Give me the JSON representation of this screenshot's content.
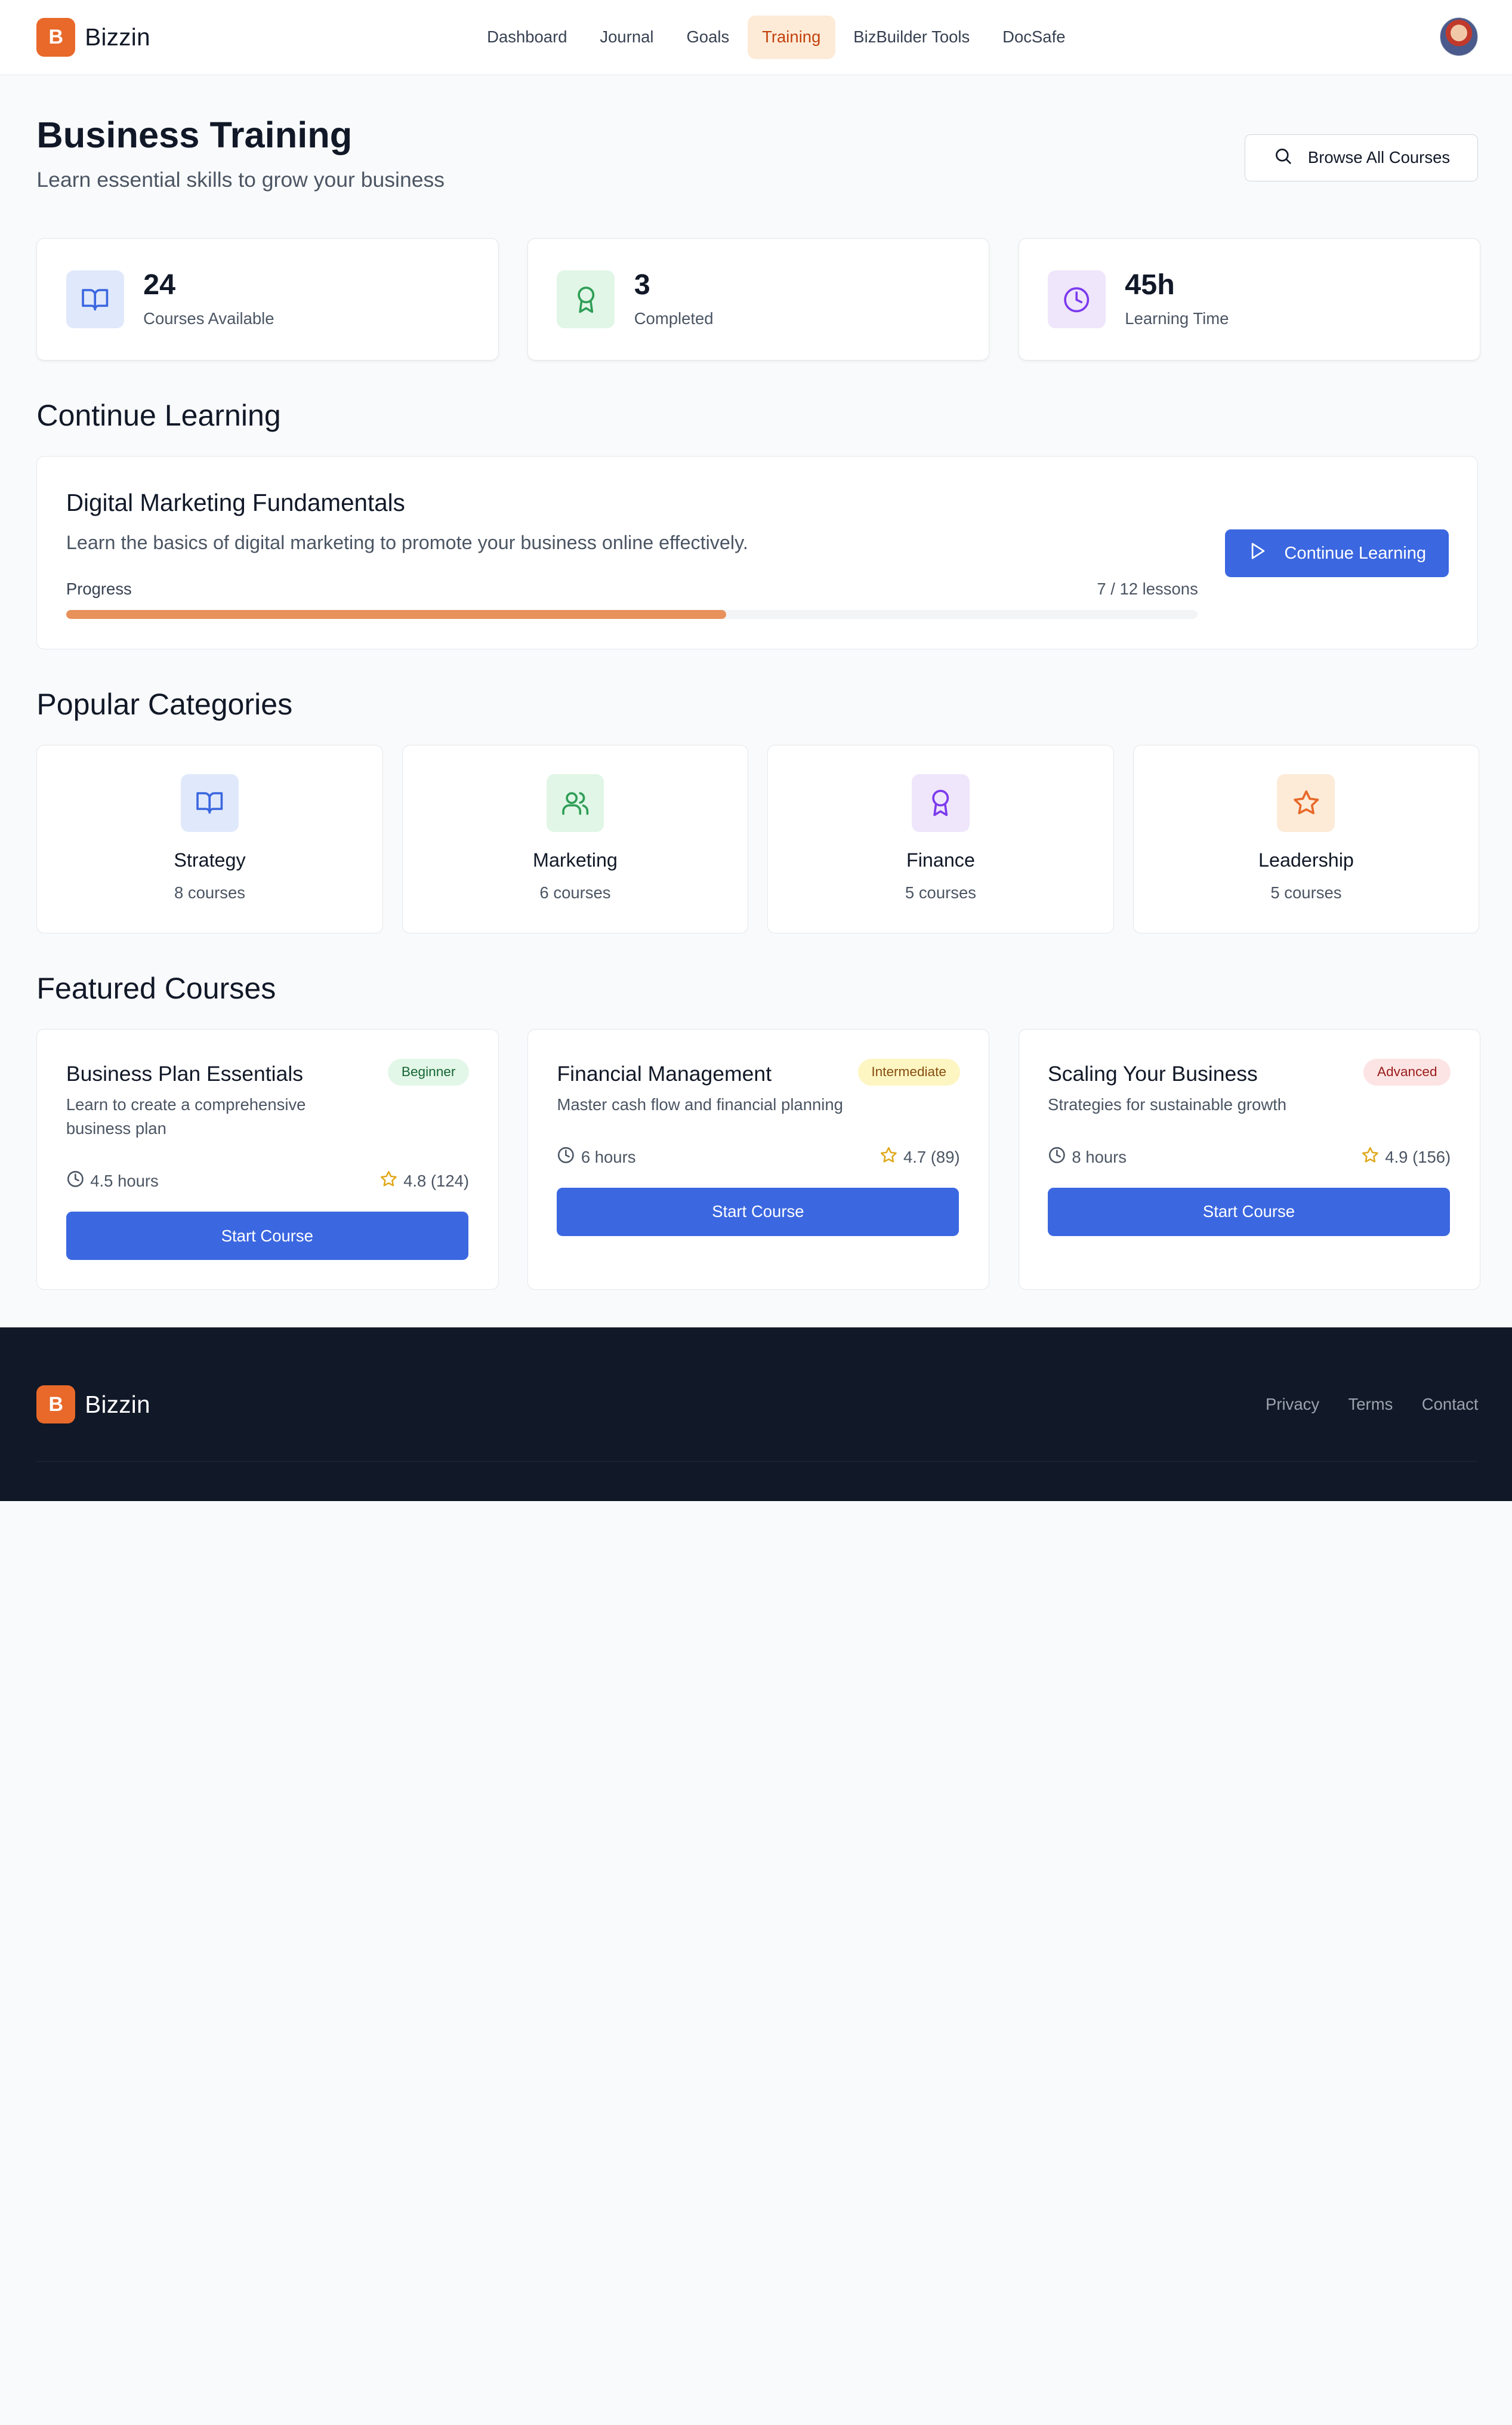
{
  "app": {
    "name": "Bizzin",
    "logo_letter": "B"
  },
  "nav": {
    "items": [
      {
        "label": "Dashboard"
      },
      {
        "label": "Journal"
      },
      {
        "label": "Goals"
      },
      {
        "label": "Training",
        "active": true
      },
      {
        "label": "BizBuilder Tools"
      },
      {
        "label": "DocSafe"
      }
    ]
  },
  "page": {
    "title": "Business Training",
    "subtitle": "Learn essential skills to grow your business",
    "browse_label": "Browse All Courses"
  },
  "stats": [
    {
      "value": "24",
      "label": "Courses Available",
      "icon": "book-open-icon"
    },
    {
      "value": "3",
      "label": "Completed",
      "icon": "award-icon"
    },
    {
      "value": "45h",
      "label": "Learning Time",
      "icon": "clock-icon"
    }
  ],
  "continue_learning": {
    "section_title": "Continue Learning",
    "course_title": "Digital Marketing Fundamentals",
    "description": "Learn the basics of digital marketing to promote your business online effectively.",
    "progress_label": "Progress",
    "progress_text": "7 / 12 lessons",
    "lessons_done": 7,
    "lessons_total": 12,
    "button_label": "Continue Learning"
  },
  "categories": {
    "section_title": "Popular Categories",
    "items": [
      {
        "name": "Strategy",
        "count": "8 courses",
        "icon": "book-open-icon"
      },
      {
        "name": "Marketing",
        "count": "6 courses",
        "icon": "users-icon"
      },
      {
        "name": "Finance",
        "count": "5 courses",
        "icon": "award-icon"
      },
      {
        "name": "Leadership",
        "count": "5 courses",
        "icon": "star-icon"
      }
    ]
  },
  "featured": {
    "section_title": "Featured Courses",
    "courses": [
      {
        "title": "Business Plan Essentials",
        "level": "Beginner",
        "description": "Learn to create a comprehensive business plan",
        "duration": "4.5 hours",
        "rating": "4.8 (124)",
        "button": "Start Course"
      },
      {
        "title": "Financial Management",
        "level": "Intermediate",
        "description": "Master cash flow and financial planning",
        "duration": "6 hours",
        "rating": "4.7 (89)",
        "button": "Start Course"
      },
      {
        "title": "Scaling Your Business",
        "level": "Advanced",
        "description": "Strategies for sustainable growth",
        "duration": "8 hours",
        "rating": "4.9 (156)",
        "button": "Start Course"
      }
    ]
  },
  "footer": {
    "links": [
      {
        "label": "Privacy"
      },
      {
        "label": "Terms"
      },
      {
        "label": "Contact"
      }
    ]
  },
  "colors": {
    "brand_orange": "#e8692a",
    "primary_blue": "#3b67e0",
    "progress_orange": "#e8915a",
    "footer_bg": "#111827"
  }
}
